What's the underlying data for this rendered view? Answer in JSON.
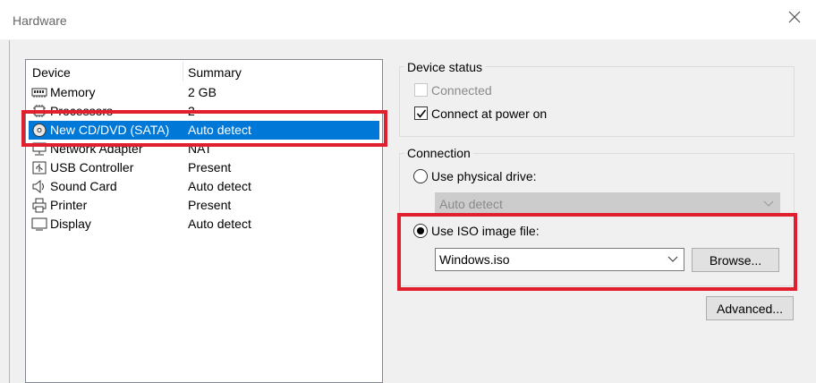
{
  "window": {
    "title": "Hardware"
  },
  "device_list": {
    "columns": {
      "device": "Device",
      "summary": "Summary"
    },
    "rows": [
      {
        "name": "Memory",
        "summary": "2 GB",
        "icon": "memory-icon"
      },
      {
        "name": "Processors",
        "summary": "2",
        "icon": "processor-icon"
      },
      {
        "name": "New CD/DVD (SATA)",
        "summary": "Auto detect",
        "icon": "cd-dvd-icon"
      },
      {
        "name": "Network Adapter",
        "summary": "NAT",
        "icon": "network-icon"
      },
      {
        "name": "USB Controller",
        "summary": "Present",
        "icon": "usb-icon"
      },
      {
        "name": "Sound Card",
        "summary": "Auto detect",
        "icon": "speaker-icon"
      },
      {
        "name": "Printer",
        "summary": "Present",
        "icon": "printer-icon"
      },
      {
        "name": "Display",
        "summary": "Auto detect",
        "icon": "monitor-icon"
      }
    ],
    "selected_index": 2
  },
  "device_status": {
    "title": "Device status",
    "connected_label": "Connected",
    "connected_checked": false,
    "connected_enabled": false,
    "power_on_label": "Connect at power on",
    "power_on_checked": true
  },
  "connection": {
    "title": "Connection",
    "physical_label": "Use physical drive:",
    "physical_value": "Auto detect",
    "iso_label": "Use ISO image file:",
    "iso_value": "Windows.iso",
    "selected": "iso",
    "browse_label": "Browse..."
  },
  "advanced_label": "Advanced...",
  "colors": {
    "selection": "#0078d7",
    "highlight": "#e0202f"
  }
}
